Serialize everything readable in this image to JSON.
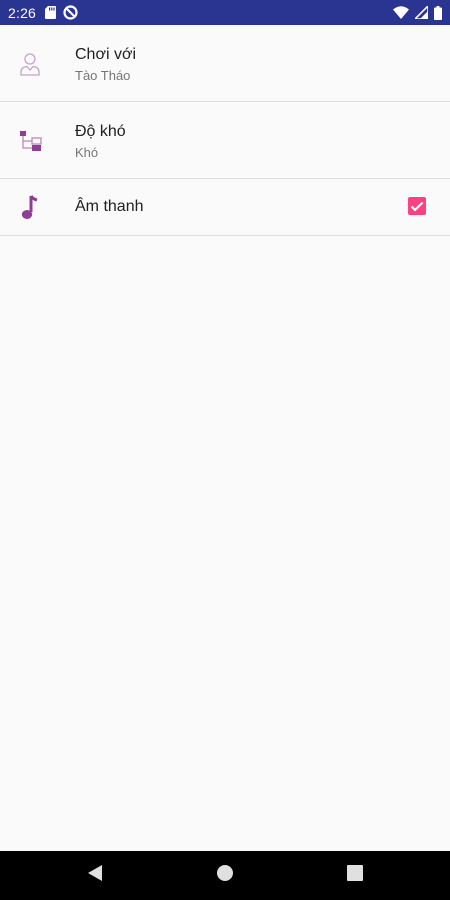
{
  "status_bar": {
    "time": "2:26",
    "background": "#2a3491",
    "icons": [
      "sd-card-icon",
      "data-saver-icon",
      "wifi-icon",
      "signal-icon",
      "battery-icon"
    ]
  },
  "settings": {
    "accent": "#8e3f95",
    "checkbox_color": "#ff4081",
    "items": [
      {
        "icon": "person-icon",
        "title": "Chơi với",
        "summary": "Tào Tháo"
      },
      {
        "icon": "hierarchy-icon",
        "title": "Độ khó",
        "summary": "Khó"
      },
      {
        "icon": "music-note-icon",
        "title": "Âm thanh",
        "checked": true
      }
    ]
  },
  "nav_bar": {
    "buttons": [
      "back-icon",
      "home-icon",
      "recents-icon"
    ]
  }
}
